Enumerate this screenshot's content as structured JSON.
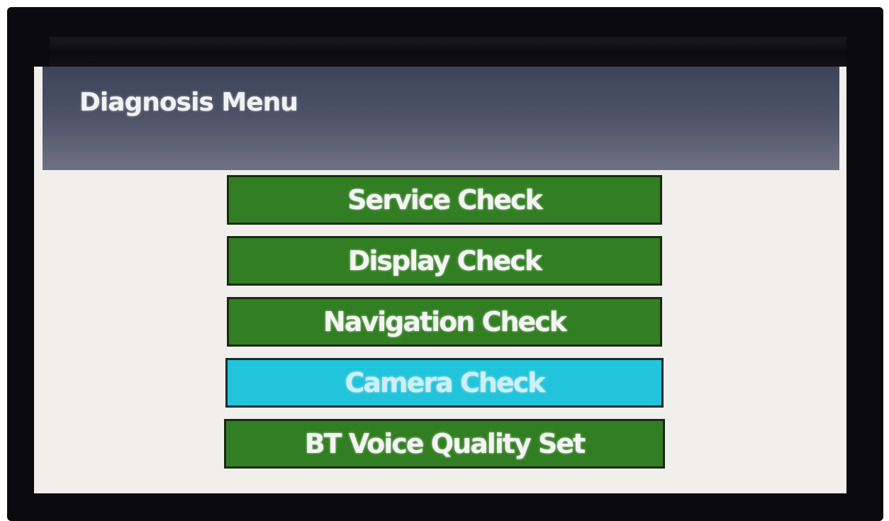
{
  "header": {
    "title": "Diagnosis Menu"
  },
  "menu": {
    "items": [
      {
        "label": "Service Check",
        "selected": false
      },
      {
        "label": "Display Check",
        "selected": false
      },
      {
        "label": "Navigation Check",
        "selected": false
      },
      {
        "label": "Camera Check",
        "selected": true
      },
      {
        "label": "BT Voice Quality Set",
        "selected": false
      }
    ]
  },
  "colors": {
    "button_green": "#327e22",
    "button_selected": "#22c4db",
    "header_bg": "#4b5166",
    "screen_bg": "#f1efec"
  }
}
